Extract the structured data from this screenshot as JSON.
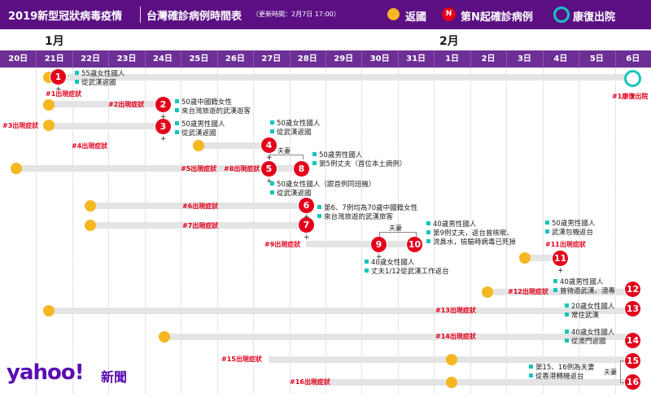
{
  "header": {
    "title": "2019新型冠狀病毒疫情",
    "chart_title": "台灣確診病例時間表",
    "updated": "（更新時間：2月7日 17:00）",
    "legend": [
      {
        "label": "返國",
        "color": "#f5b722"
      },
      {
        "label": "第N起確診病例",
        "badge": "N",
        "color": "#e3001b"
      },
      {
        "label": "康復出院",
        "color": "#14c5bd"
      }
    ]
  },
  "months": [
    "1月",
    "2月"
  ],
  "days": [
    "20日",
    "21日",
    "22日",
    "23日",
    "24日",
    "25日",
    "26日",
    "27日",
    "28日",
    "29日",
    "30日",
    "31日",
    "1日",
    "2日",
    "3日",
    "4日",
    "5日",
    "6日"
  ],
  "cases": [
    {
      "no": "1",
      "onset_label": "#1出現症狀",
      "notes": [
        "55歲女性國人",
        "從武漢返國"
      ],
      "recovered_label": "#1康復出院"
    },
    {
      "no": "2",
      "onset_label": "#2出現症狀",
      "notes": [
        "50歲中國籍女性",
        "來台灣旅遊的武漢遊客"
      ]
    },
    {
      "no": "3",
      "onset_label": "#3出現症狀",
      "notes": [
        "50歲男性國人",
        "從武漢返國"
      ]
    },
    {
      "no": "4",
      "onset_label": "#4出現症狀",
      "notes": [
        "50歲女性國人",
        "從武漢返國"
      ]
    },
    {
      "no": "5",
      "onset_label": "#5出現症狀",
      "notes": [
        "50歲女性國人（跟首例同班機）",
        "從武漢返國"
      ]
    },
    {
      "no": "6",
      "onset_label": "#6出現症狀",
      "notes": [
        "第6、7例均為70歲中國籍女性",
        "來台灣旅遊的武漢旅客"
      ]
    },
    {
      "no": "7",
      "onset_label": "#7出現症狀"
    },
    {
      "no": "8",
      "onset_label": "#8出現症狀",
      "notes": [
        "50歲男性國人",
        "第5例丈夫（首位本土病例）"
      ]
    },
    {
      "no": "9",
      "onset_label": "#9出現症狀",
      "notes": [
        "40歲女性國人",
        "丈夫1/12從武漢工作返台"
      ]
    },
    {
      "no": "10",
      "notes": [
        "40歲男性國人",
        "第9例丈夫，返台曾咳嗽、",
        "流鼻水，檢驗時病毒已死掉"
      ]
    },
    {
      "no": "11",
      "onset_label": "#11出現症狀",
      "notes": [
        "50歲男性國人",
        "武漢包機返台"
      ]
    },
    {
      "no": "12",
      "onset_label": "#12出現症狀",
      "notes": [
        "40歲男性國人",
        "曾待過武漢、澳專"
      ]
    },
    {
      "no": "13",
      "onset_label": "#13出現症狀",
      "notes": [
        "20歲女性國人",
        "常住武漢"
      ]
    },
    {
      "no": "14",
      "onset_label": "#14出現症狀",
      "notes": [
        "40歲女性國人",
        "從澳門返國"
      ]
    },
    {
      "no": "15",
      "onset_label": "#15出現症狀",
      "notes": [
        "第15、16例為夫妻",
        "從香港轉機返台"
      ]
    },
    {
      "no": "16",
      "onset_label": "#16出現症狀"
    }
  ],
  "spouse_label": "夫妻",
  "brand": {
    "logo": "yahoo!",
    "sub": "新聞"
  }
}
